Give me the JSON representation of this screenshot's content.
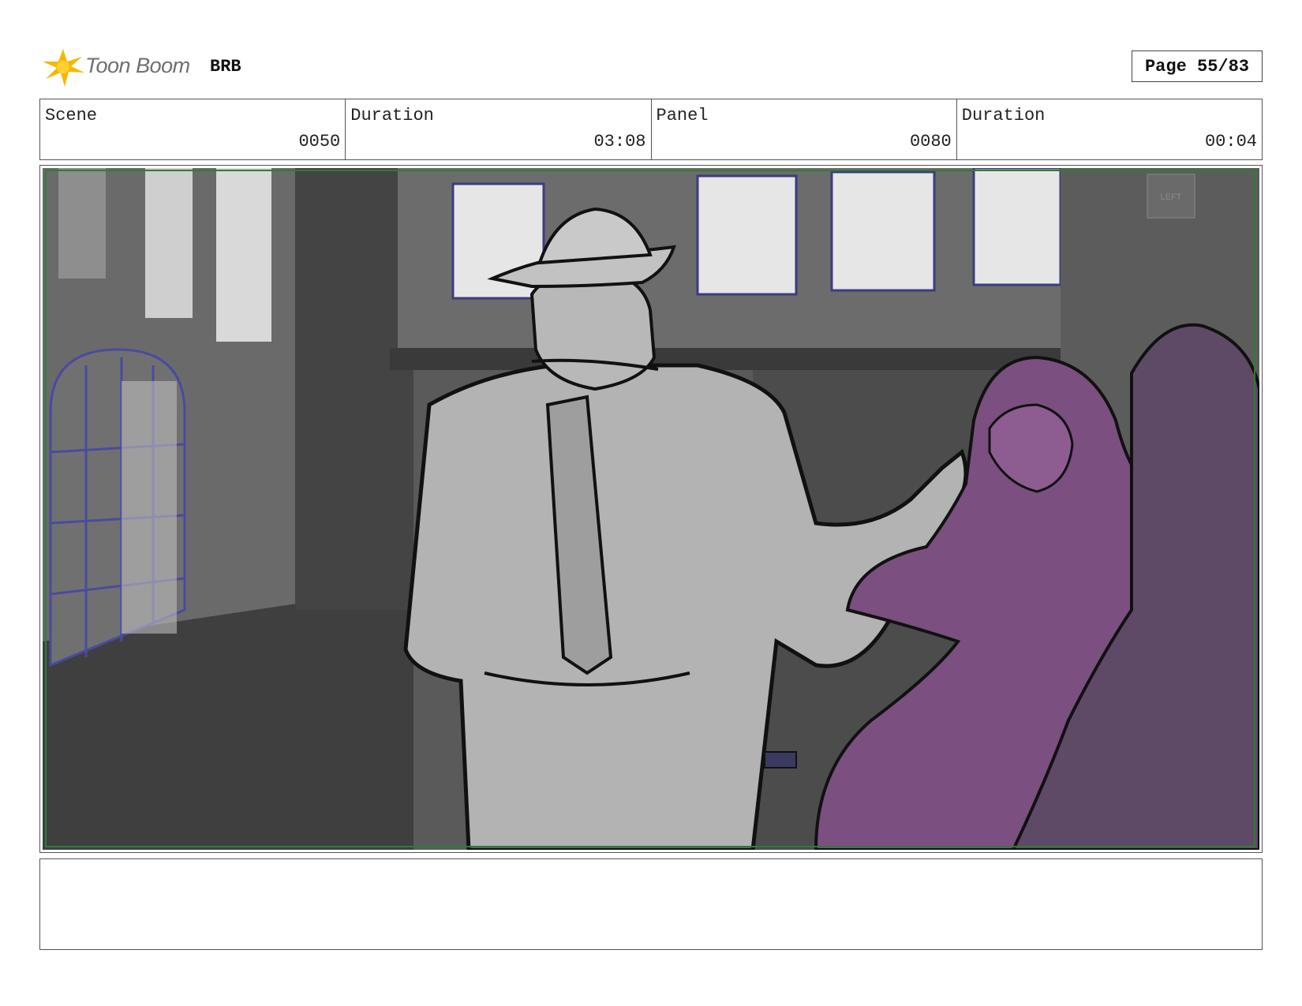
{
  "header": {
    "logo_text": "Toon Boom",
    "project": "BRB",
    "page": "Page 55/83"
  },
  "info": [
    {
      "label": "Scene",
      "value": "0050"
    },
    {
      "label": "Duration",
      "value": "03:08"
    },
    {
      "label": "Panel",
      "value": "0080"
    },
    {
      "label": "Duration",
      "value": "00:04"
    }
  ],
  "panel": {
    "sign_text": "LEFT"
  },
  "notes": {
    "text": ""
  },
  "colors": {
    "logo_yellow": "#f5b800",
    "safe_frame_green": "#2e7d32",
    "character_purple": "#7b4f80",
    "coat_gray": "#b3b3b3",
    "wall_dark": "#4a4a4a"
  }
}
